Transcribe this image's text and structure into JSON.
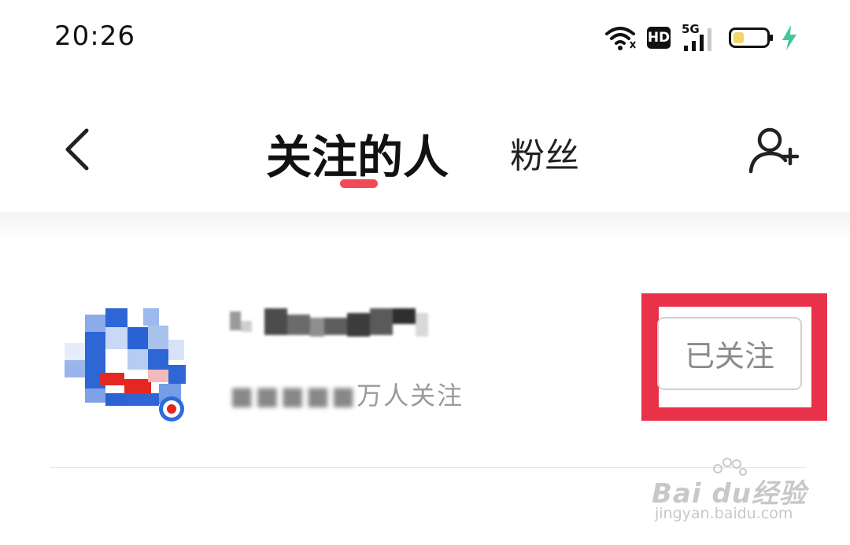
{
  "status_bar": {
    "time": "20:26",
    "hd_label": "HD",
    "network_label": "5G",
    "icons": [
      "wifi-icon",
      "hd-icon",
      "5g-signal-icon",
      "battery-icon",
      "charging-icon"
    ]
  },
  "header": {
    "tabs": [
      {
        "label": "关注的人",
        "active": true
      },
      {
        "label": "粉丝",
        "active": false
      }
    ],
    "accent_color": "#ef4a56"
  },
  "list": {
    "items": [
      {
        "name": "",
        "followers_text": "万人关注",
        "follow_button_label": "已关注"
      }
    ]
  },
  "highlight_color": "#e93149",
  "watermark": {
    "brand": "Bai du经验",
    "url": "jingyan.baidu.com"
  }
}
